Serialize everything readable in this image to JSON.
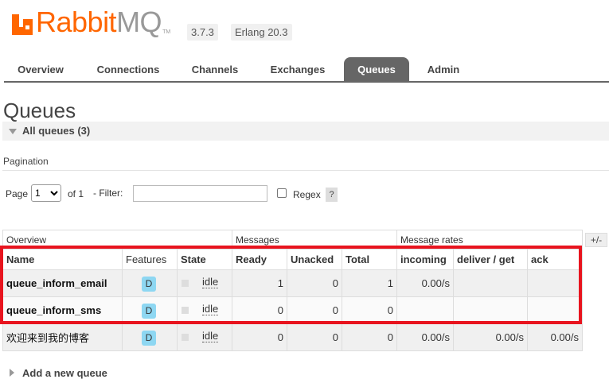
{
  "header": {
    "logo_rabbit": "Rabbit",
    "logo_mq": "MQ",
    "trademark": "TM",
    "version": "3.7.3",
    "erlang": "Erlang 20.3"
  },
  "tabs": [
    {
      "label": "Overview",
      "active": false
    },
    {
      "label": "Connections",
      "active": false
    },
    {
      "label": "Channels",
      "active": false
    },
    {
      "label": "Exchanges",
      "active": false
    },
    {
      "label": "Queues",
      "active": true
    },
    {
      "label": "Admin",
      "active": false
    }
  ],
  "page": {
    "title": "Queues",
    "section_title": "All queues (3)",
    "pagination_label": "Pagination"
  },
  "pager": {
    "page_label": "Page",
    "page_value": "1",
    "of_label": "of 1",
    "filter_label": "- Filter:",
    "filter_value": "",
    "regex_label": "Regex",
    "help_label": "?"
  },
  "table": {
    "groups": [
      "Overview",
      "Messages",
      "Message rates"
    ],
    "columns": [
      "Name",
      "Features",
      "State",
      "Ready",
      "Unacked",
      "Total",
      "incoming",
      "deliver / get",
      "ack"
    ],
    "toggle_label": "+/-",
    "rows": [
      {
        "name": "queue_inform_email",
        "feature": "D",
        "state": "idle",
        "ready": "1",
        "unacked": "0",
        "total": "1",
        "incoming": "0.00/s",
        "deliver": "",
        "ack": ""
      },
      {
        "name": "queue_inform_sms",
        "feature": "D",
        "state": "idle",
        "ready": "0",
        "unacked": "0",
        "total": "0",
        "incoming": "",
        "deliver": "",
        "ack": ""
      },
      {
        "name": "欢迎来到我的博客",
        "feature": "D",
        "state": "idle",
        "ready": "0",
        "unacked": "0",
        "total": "0",
        "incoming": "0.00/s",
        "deliver": "0.00/s",
        "ack": "0.00/s"
      }
    ]
  },
  "footer": {
    "add_queue": "Add a new queue"
  },
  "colors": {
    "brand": "#ff6600",
    "tab_active": "#666666",
    "highlight": "#e8141e",
    "feature_badge": "#8ed7f2"
  }
}
